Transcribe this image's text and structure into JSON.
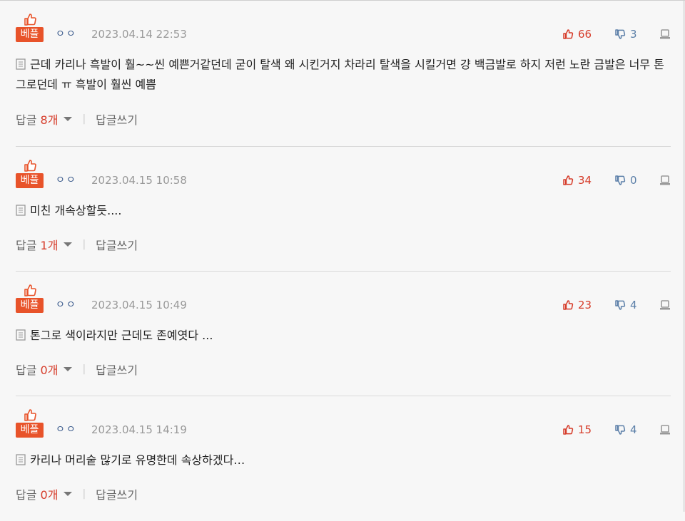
{
  "colors": {
    "best_badge": "#e8532a",
    "upvote": "#d63c2a",
    "downvote": "#5b7fa8",
    "date": "#999999"
  },
  "icons": {
    "thumb": "thumbs-up-icon",
    "upvote": "thumbs-up-icon",
    "downvote": "thumbs-down-icon",
    "report": "report-icon",
    "doc": "document-icon",
    "caret": "chevron-down-icon"
  },
  "comments": [
    {
      "badge": "베플",
      "nick": "ㅇㅇ",
      "date": "2023.04.14 22:53",
      "up": "66",
      "down": "3",
      "text": "근데 카리나 흑발이 훨~~씬 예쁜거같던데 굳이 탈색 왜 시킨거지 차라리 탈색을 시킬거면 걍 백금발로 하지 저런 노란 금발은 너무 톤그로던데 ㅠ 흑발이 훨씬 예쁨",
      "reply_label": "답글",
      "reply_count": "8개",
      "write_reply": "답글쓰기"
    },
    {
      "badge": "베플",
      "nick": "ㅇㅇ",
      "date": "2023.04.15 10:58",
      "up": "34",
      "down": "0",
      "text": "미친 개속상할듯....",
      "reply_label": "답글",
      "reply_count": "1개",
      "write_reply": "답글쓰기"
    },
    {
      "badge": "베플",
      "nick": "ㅇㅇ",
      "date": "2023.04.15 10:49",
      "up": "23",
      "down": "4",
      "text": "톤그로 색이라지만 근데도 존예엿다 ...",
      "reply_label": "답글",
      "reply_count": "0개",
      "write_reply": "답글쓰기"
    },
    {
      "badge": "베플",
      "nick": "ㅇㅇ",
      "date": "2023.04.15 14:19",
      "up": "15",
      "down": "4",
      "text": "카리나 머리숱 많기로 유명한데 속상하겠다…",
      "reply_label": "답글",
      "reply_count": "0개",
      "write_reply": "답글쓰기"
    }
  ]
}
